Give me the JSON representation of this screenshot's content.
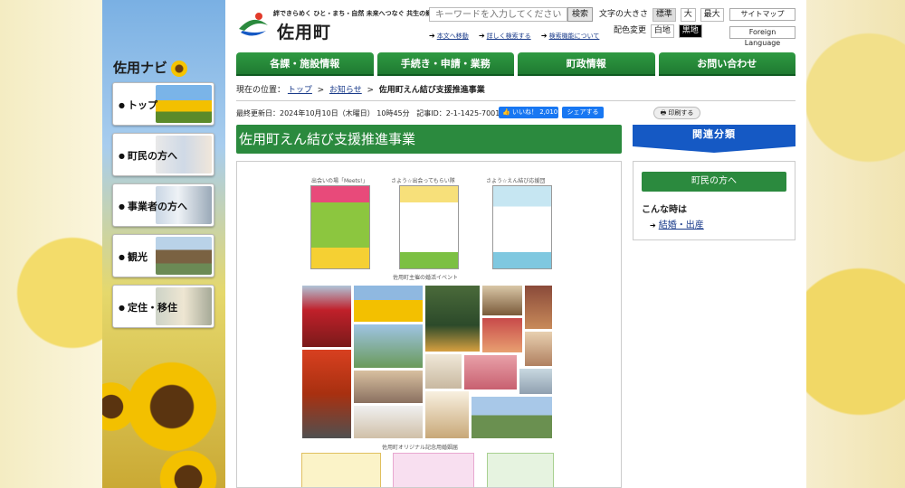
{
  "site": {
    "tagline": "絆できらめく ひと・まち・自然 未来へつなぐ 共生の郷",
    "name": "佐用町"
  },
  "search": {
    "placeholder": "キーワードを入力してください",
    "button": "検索"
  },
  "links": [
    "本文へ移動",
    "詳しく検索する",
    "検索機能について"
  ],
  "font_size": {
    "label": "文字の大きさ",
    "options": [
      "標準",
      "大",
      "最大"
    ]
  },
  "color_change": {
    "label": "配色変更",
    "options": [
      "白地",
      "黒地"
    ]
  },
  "top_links": [
    "サイトマップ",
    "Foreign Language"
  ],
  "global_nav": [
    "各課・施設情報",
    "手続き・申請・業務",
    "町政情報",
    "お問い合わせ"
  ],
  "breadcrumb": {
    "label": "現在の位置：",
    "items": [
      "トップ",
      "お知らせ"
    ],
    "sep": ">",
    "current": "佐用町えん結び支援推進事業"
  },
  "meta": {
    "updated": "最終更新日：2024年10月10日（木曜日） 10時45分",
    "article_id": "記事ID：2-1-1425-7001",
    "like_label": "いいね！",
    "like_count": "2,010",
    "share": "シェアする",
    "print": "印刷する"
  },
  "page_title": "佐用町えん結び支援推進事業",
  "content": {
    "flyer_captions": [
      "出会いの場「Meets!」",
      "さよう☆出会ってもらい隊",
      "さよう☆えん結び応援団"
    ],
    "caption_event": "佐用町主催の婚活イベント",
    "caption_cert": "佐用町オリジナル記念用婚姻届"
  },
  "left_nav": {
    "title": "佐用ナビ",
    "items": [
      "トップ",
      "町民の方へ",
      "事業者の方へ",
      "観光",
      "定住・移住"
    ]
  },
  "sidebar": {
    "heading": "関連分類",
    "category": "町民の方へ",
    "when": "こんな時は",
    "link": "結婚・出産"
  }
}
